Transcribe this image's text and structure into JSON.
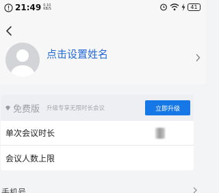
{
  "status_bar": {
    "time": "21:49",
    "net_speed_value": "0.10",
    "net_speed_unit": "KB/S",
    "battery": "41",
    "icons": [
      "alert-icon",
      "alarm-icon",
      "wifi-icon",
      "charging-icon"
    ]
  },
  "profile": {
    "name": "点击设置姓名",
    "name_color": "#2369d6",
    "back_icon": "chevron-left-icon",
    "chevron_icon": "chevron-right-icon"
  },
  "plan": {
    "icon": "gem-icon",
    "name": "免费版",
    "description": "升级专享无限时长会议",
    "upgrade_label": "立即升级",
    "upgrade_color": "#1677e6"
  },
  "settings": {
    "rows": [
      {
        "label": "单次会议时长"
      },
      {
        "label": "会议人数上限"
      }
    ]
  },
  "bottom": {
    "label": "手机号"
  }
}
